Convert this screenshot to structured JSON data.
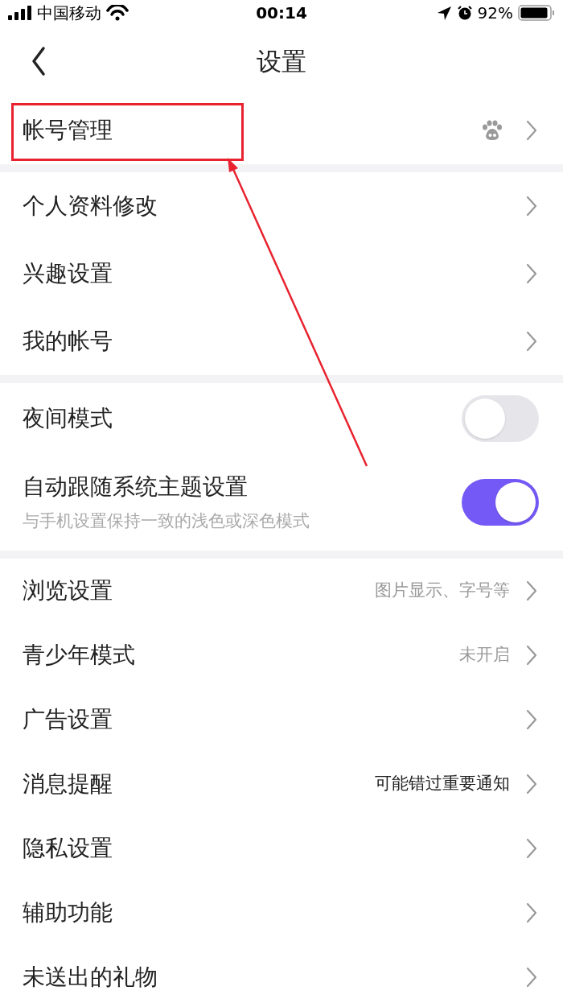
{
  "status_bar": {
    "carrier": "中国移动",
    "time": "00:14",
    "battery": "92%"
  },
  "nav": {
    "title": "设置"
  },
  "groups": [
    {
      "items": [
        {
          "kind": "link",
          "label": "帐号管理"
        }
      ]
    },
    {
      "items": [
        {
          "kind": "link",
          "label": "个人资料修改"
        },
        {
          "kind": "link",
          "label": "兴趣设置"
        },
        {
          "kind": "link",
          "label": "我的帐号"
        }
      ]
    },
    {
      "items": [
        {
          "kind": "toggle",
          "label": "夜间模式",
          "on": false
        },
        {
          "kind": "toggle",
          "label": "自动跟随系统主题设置",
          "subtitle": "与手机设置保持一致的浅色或深色模式",
          "on": true
        }
      ]
    },
    {
      "items": [
        {
          "kind": "link",
          "label": "浏览设置",
          "hint": "图片显示、字号等"
        },
        {
          "kind": "link",
          "label": "青少年模式",
          "hint": "未开启"
        },
        {
          "kind": "link",
          "label": "广告设置"
        },
        {
          "kind": "link",
          "label": "消息提醒",
          "hint": "可能错过重要通知",
          "hint_strong": true
        },
        {
          "kind": "link",
          "label": "隐私设置"
        },
        {
          "kind": "link",
          "label": "辅助功能"
        },
        {
          "kind": "link",
          "label": "未送出的礼物"
        }
      ]
    }
  ],
  "annotations": {
    "highlight_box": true,
    "arrow": true
  }
}
